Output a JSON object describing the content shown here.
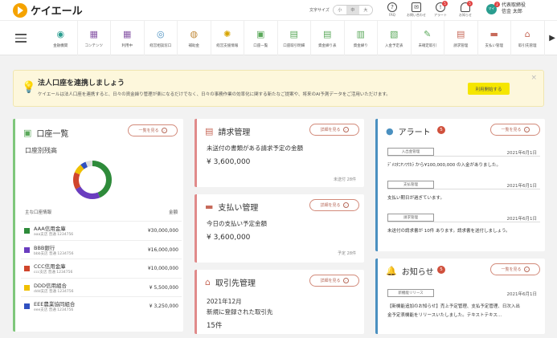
{
  "header": {
    "logo": "ケイエール",
    "font_size_label": "文字サイズ",
    "font_sizes": [
      "小",
      "中",
      "大"
    ],
    "icons": [
      {
        "icon": "question-icon",
        "label": "FAQ"
      },
      {
        "icon": "mail-icon",
        "label": "お問い合わせ"
      },
      {
        "icon": "alert-icon",
        "label": "アラート"
      },
      {
        "icon": "bell-icon",
        "label": "お知らせ"
      }
    ],
    "alert_badge": "5",
    "bell_badge": "5",
    "avatar_label": "マイ",
    "avatar_badge": "2",
    "user_role": "代表取締役",
    "user_name": "信金 太郎"
  },
  "nav": {
    "items": [
      {
        "icon": "partner-icon",
        "label": "金融機関"
      },
      {
        "icon": "content-icon",
        "label": "コンテンツ"
      },
      {
        "icon": "usage-icon",
        "label": "利用中"
      },
      {
        "icon": "consult-icon",
        "label": "経営相談窓口"
      },
      {
        "icon": "chart-icon",
        "label": "補助金"
      },
      {
        "icon": "bulb-icon",
        "label": "経営支援情報"
      },
      {
        "icon": "account-icon",
        "label": "口座一覧"
      },
      {
        "icon": "statement-icon",
        "label": "口座取引明細"
      },
      {
        "icon": "cashflow-icon",
        "label": "資金繰り表"
      },
      {
        "icon": "analysis-icon",
        "label": "資金繰り"
      },
      {
        "icon": "deposit-icon",
        "label": "入金予定表"
      },
      {
        "icon": "expense-icon",
        "label": "未確定取引"
      },
      {
        "icon": "invoice-icon",
        "label": "請求管理"
      },
      {
        "icon": "payment-icon",
        "label": "支払い管理"
      },
      {
        "icon": "client-icon",
        "label": "取引先管理"
      }
    ]
  },
  "banner": {
    "title": "法人口座を連携しましょう",
    "text": "ケイエールは法人口座を連携すると、日々の資金繰り管理が楽になるだけでなく、日々の事務作業の効率化に関する新たなご提案や、将来のAI予測データをご活用いただけます。",
    "button": "利用開始する",
    "close": "×"
  },
  "accounts": {
    "title": "口座一覧",
    "more": "一覧を見る",
    "subtitle": "口座別残高",
    "col_name": "主な口座情報",
    "col_amount": "金額",
    "rows": [
      {
        "name": "AAA信用金庫",
        "sub": "aaa支店 普通 1234756",
        "amount": "¥30,000,000",
        "color": "#2e8b3a"
      },
      {
        "name": "BBB銀行",
        "sub": "bbb支店 普通 1234756",
        "amount": "¥16,000,000",
        "color": "#6a3dbf"
      },
      {
        "name": "CCC信用金庫",
        "sub": "ccc支店 普通 1234756",
        "amount": "¥10,000,000",
        "color": "#d0452c"
      },
      {
        "name": "DDD信用組合",
        "sub": "ddd支店 普通 1234756",
        "amount": "¥ 5,500,000",
        "color": "#f0c000"
      },
      {
        "name": "EEE農業協同組合",
        "sub": "eee支店 普通 1234756",
        "amount": "¥ 3,250,000",
        "color": "#3050c0"
      }
    ]
  },
  "invoice": {
    "title": "請求管理",
    "more": "詳細を見る",
    "desc": "未送付の書類がある請求予定の金額",
    "amount": "¥ 3,600,000",
    "foot": "未送付 28件"
  },
  "payment": {
    "title": "支払い管理",
    "more": "詳細を見る",
    "desc": "今日の支払い予定金額",
    "amount": "¥ 3,600,000",
    "foot": "予定 28件"
  },
  "client": {
    "title": "取引先管理",
    "more": "詳細を見る",
    "period": "2021年12月",
    "desc": "新規に登録された取引先",
    "count": "15件"
  },
  "alerts": {
    "title": "アラート",
    "badge": "5",
    "more": "一覧を見る",
    "items": [
      {
        "tag": "入出金管理",
        "date": "2021年6月1日",
        "text": "ﾃﾞﾒｽﾀﾆﾔﾝﾜｳｶﾗ から¥100,000,000 の入金がありました。"
      },
      {
        "tag": "支払管理",
        "date": "2021年6月1日",
        "text": "支払い期日が過ぎています。"
      },
      {
        "tag": "請求管理",
        "date": "2021年6月1日",
        "text": "未送付の請求書が 10件 あります。請求書を送付しましょう。"
      }
    ]
  },
  "news": {
    "title": "お知らせ",
    "badge": "5",
    "more": "一覧を見る",
    "tag": "新機能リリース",
    "date": "2021年6月1日",
    "text1": "【新機能追加のお知らせ】売上予定管理、支払予定管理、日次入出",
    "text2": "金予定表機能をリリースいたしました。テキストテキス..."
  }
}
